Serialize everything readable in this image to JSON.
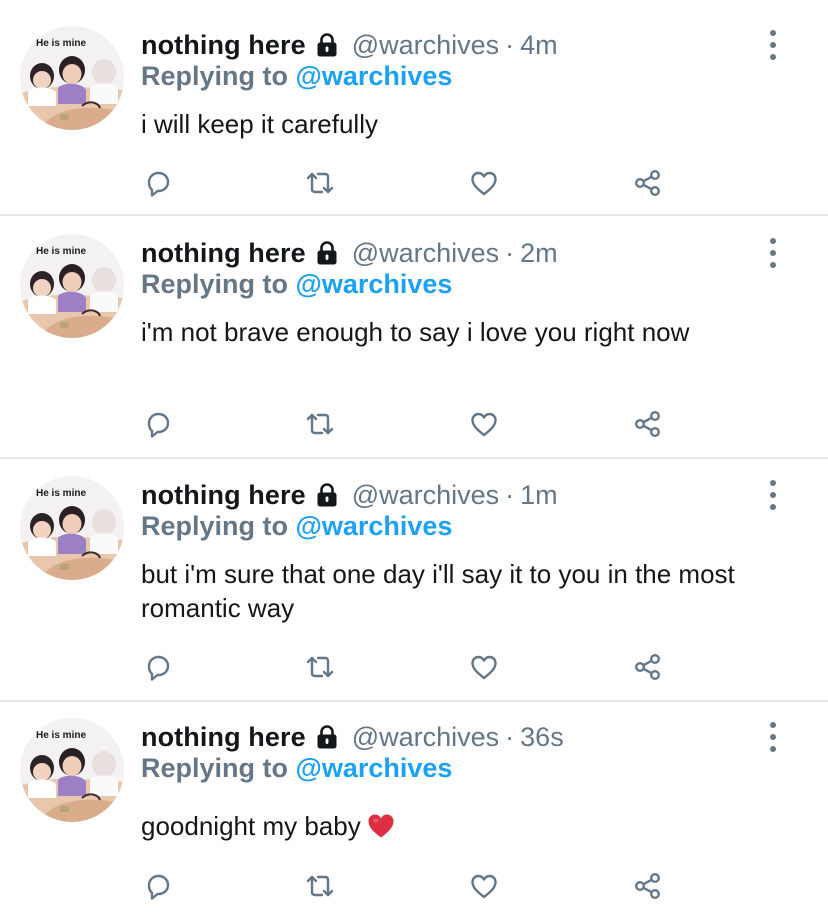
{
  "avatar": {
    "caption": "He is mine",
    "icon": "profile-photo"
  },
  "colors": {
    "name": "#14171a",
    "muted": "#657786",
    "link": "#1da1f2",
    "divider": "#e1e8ed",
    "heart": "#e0245e"
  },
  "tweets": [
    {
      "display_name": "nothing here",
      "handle": "@warchives",
      "separator": "·",
      "time": "4m",
      "reply_label": "Replying to",
      "reply_target": "@warchives",
      "text": "i will keep it carefully"
    },
    {
      "display_name": "nothing here",
      "handle": "@warchives",
      "separator": "·",
      "time": "2m",
      "reply_label": "Replying to",
      "reply_target": "@warchives",
      "text": "i'm not brave enough to say i love you right now"
    },
    {
      "display_name": "nothing here",
      "handle": "@warchives",
      "separator": "·",
      "time": "1m",
      "reply_label": "Replying to",
      "reply_target": "@warchives",
      "text": "but i'm sure that one day i'll say it to you in the most romantic way"
    },
    {
      "display_name": "nothing here",
      "handle": "@warchives",
      "separator": "·",
      "time": "36s",
      "reply_label": "Replying to",
      "reply_target": "@warchives",
      "text": "goodnight my baby",
      "emoji": "red-heart-icon"
    }
  ]
}
